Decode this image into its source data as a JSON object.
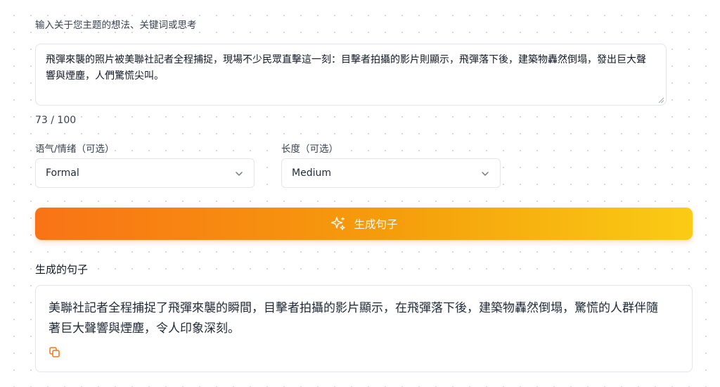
{
  "prompt": {
    "label": "输入关于您主题的想法、关键词或思考",
    "value": "飛彈來襲的照片被美聯社記者全程捕捉，現場不少民眾直擊這一刻：目擊者拍攝的影片則顯示，飛彈落下後，建築物轟然倒塌，發出巨大聲響與煙塵，人們驚慌尖叫。",
    "char_count": "73 / 100"
  },
  "options": {
    "tone": {
      "label": "语气/情绪（可选）",
      "value": "Formal",
      "icon": "chevron-down-icon"
    },
    "length": {
      "label": "长度（可选）",
      "value": "Medium",
      "icon": "chevron-down-icon"
    }
  },
  "generate_button": {
    "label": "生成句子",
    "icon": "sparkle-icon",
    "gradient_start": "#f97316",
    "gradient_end": "#facc15"
  },
  "result": {
    "title": "生成的句子",
    "text": "美聯社記者全程捕捉了飛彈來襲的瞬間，目擊者拍攝的影片顯示，在飛彈落下後，建築物轟然倒塌，驚慌的人群伴隨著巨大聲響與煙塵，令人印象深刻。",
    "copy_icon": "copy-icon",
    "accent_color": "#f97316"
  }
}
